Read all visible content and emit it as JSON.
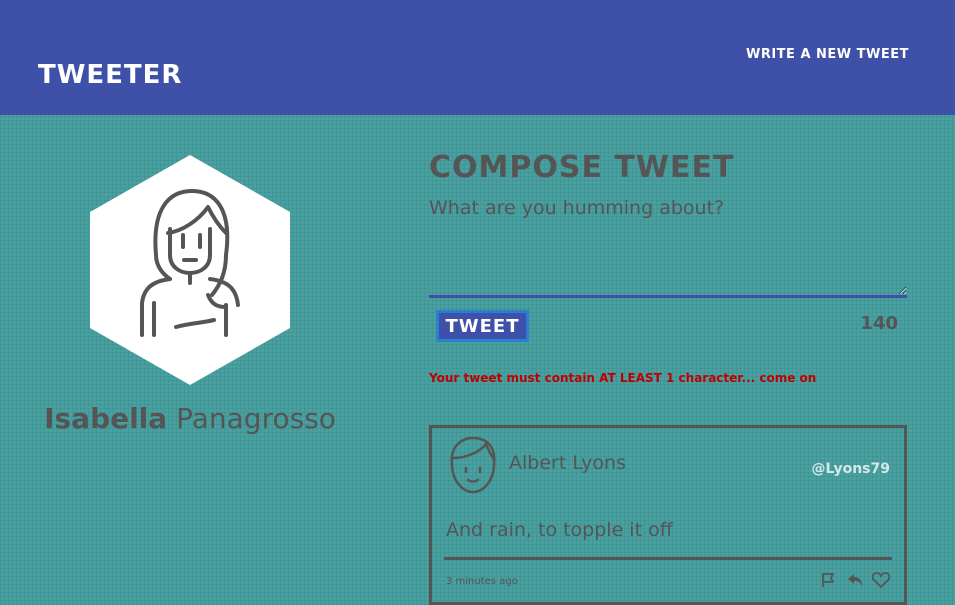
{
  "navbar": {
    "brand": "TWEETER",
    "compose_link": "WRITE A NEW TWEET"
  },
  "profile": {
    "first_name": "Isabella",
    "last_name": "Panagrosso",
    "avatar_icon": "woman-avatar-icon"
  },
  "compose": {
    "title": "COMPOSE TWEET",
    "placeholder": "What are you humming about?",
    "value": "",
    "button_label": "TWEET",
    "char_count": "140",
    "error": "Your tweet must contain AT LEAST 1 character... come on"
  },
  "tweets": [
    {
      "author": "Albert Lyons",
      "handle": "@Lyons79",
      "body": "And rain, to topple it off",
      "time": "3 minutes ago",
      "avatar_icon": "man-avatar-icon",
      "actions": [
        "flag-icon",
        "retweet-icon",
        "heart-icon"
      ]
    }
  ],
  "colors": {
    "navbar": "#3f50a8",
    "background": "#4aa0a0",
    "error": "#c00000",
    "text": "#555555"
  }
}
